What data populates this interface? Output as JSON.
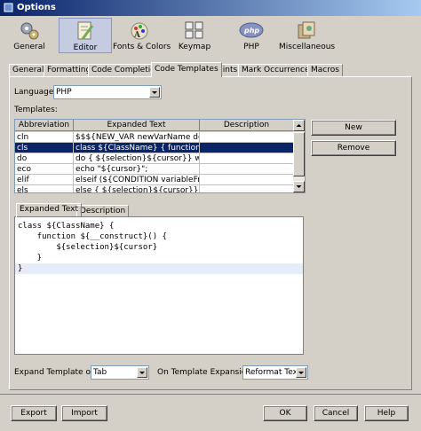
{
  "window": {
    "title": "Options"
  },
  "toolbar": [
    {
      "label": "General",
      "icon": "gears-icon"
    },
    {
      "label": "Editor",
      "icon": "editor-icon"
    },
    {
      "label": "Fonts & Colors",
      "icon": "fonts-colors-icon"
    },
    {
      "label": "Keymap",
      "icon": "keymap-icon"
    },
    {
      "label": "PHP",
      "icon": "php-icon"
    },
    {
      "label": "Miscellaneous",
      "icon": "miscellaneous-icon"
    }
  ],
  "tabs": [
    "General",
    "Formatting",
    "Code Completion",
    "Code Templates",
    "Hints",
    "Mark Occurrences",
    "Macros"
  ],
  "language": {
    "label": "Language:",
    "value": "PHP"
  },
  "templates": {
    "label": "Templates:",
    "columns": [
      "Abbreviation",
      "Expanded Text",
      "Description"
    ],
    "rows": [
      {
        "abbr": "cln",
        "text": "$$${NEW_VAR newVarName defa...",
        "desc": ""
      },
      {
        "abbr": "cls",
        "text": "class ${ClassName} {    function $...",
        "desc": ""
      },
      {
        "abbr": "do",
        "text": "do {    ${selection}${cursor}} whil...",
        "desc": ""
      },
      {
        "abbr": "eco",
        "text": "echo \"${cursor}\";",
        "desc": ""
      },
      {
        "abbr": "elif",
        "text": "elseif (${CONDITION variableFro...",
        "desc": ""
      },
      {
        "abbr": "els",
        "text": "else {    ${selection}${cursor}}",
        "desc": ""
      }
    ],
    "new_label": "New",
    "remove_label": "Remove"
  },
  "subtabs": [
    "Expanded Text",
    "Description"
  ],
  "code": [
    "class ${ClassName} {",
    "    function ${__construct}() {",
    "        ${selection}${cursor}",
    "    }",
    "}"
  ],
  "expand_on": {
    "label": "Expand Template on:",
    "value": "Tab"
  },
  "on_expansion": {
    "label": "On Template Expansion:",
    "value": "Reformat Text"
  },
  "buttons": {
    "export": "Export",
    "import": "Import",
    "ok": "OK",
    "cancel": "Cancel",
    "help": "Help"
  }
}
